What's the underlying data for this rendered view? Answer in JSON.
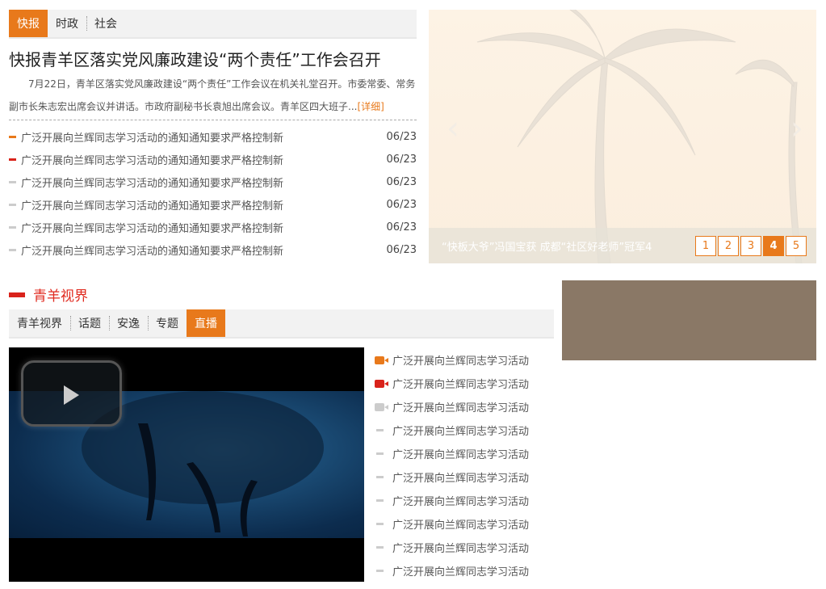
{
  "top_tabs": [
    {
      "label": "快报",
      "active": true
    },
    {
      "label": "时政"
    },
    {
      "label": "社会"
    }
  ],
  "headline": "快报青羊区落实党风廉政建设“两个责任”工作会召开",
  "summary": {
    "text": "7月22日，青羊区落实党风廉政建设“两个责任”工作会议在机关礼堂召开。市委常委、常务副市长朱志宏出席会议并讲话。市政府副秘书长袁旭出席会议。青羊区四大班子...",
    "more_label": "[详细]"
  },
  "news": [
    {
      "title": "广泛开展向兰辉同志学习活动的通知通知要求严格控制新",
      "date": "06/23",
      "bullet": "#e8791b"
    },
    {
      "title": "广泛开展向兰辉同志学习活动的通知通知要求严格控制新",
      "date": "06/23",
      "bullet": "#d9231b"
    },
    {
      "title": "广泛开展向兰辉同志学习活动的通知通知要求严格控制新",
      "date": "06/23",
      "bullet": "#cccccc"
    },
    {
      "title": "广泛开展向兰辉同志学习活动的通知通知要求严格控制新",
      "date": "06/23",
      "bullet": "#cccccc"
    },
    {
      "title": "广泛开展向兰辉同志学习活动的通知通知要求严格控制新",
      "date": "06/23",
      "bullet": "#cccccc"
    },
    {
      "title": "广泛开展向兰辉同志学习活动的通知通知要求严格控制新",
      "date": "06/23",
      "bullet": "#cccccc"
    }
  ],
  "slider": {
    "caption": "“快板大爷”冯国宝获 成都“社区好老师”冠军4",
    "pages": [
      "1",
      "2",
      "3",
      "4",
      "5"
    ],
    "active_page": "4"
  },
  "section_title": "青羊视界",
  "section_tabs": [
    {
      "label": "青羊视界"
    },
    {
      "label": "话题"
    },
    {
      "label": "安逸"
    },
    {
      "label": "专题"
    },
    {
      "label": "直播",
      "active": true
    }
  ],
  "video_list": [
    {
      "title": "广泛开展向兰辉同志学习活动",
      "icon": "video-camera-icon",
      "color": "#e8791b"
    },
    {
      "title": "广泛开展向兰辉同志学习活动",
      "icon": "video-camera-icon",
      "color": "#d9231b"
    },
    {
      "title": "广泛开展向兰辉同志学习活动",
      "icon": "video-camera-icon",
      "color": "#cccccc"
    },
    {
      "title": "广泛开展向兰辉同志学习活动",
      "icon": "dash-bullet-icon",
      "color": "#cccccc"
    },
    {
      "title": "广泛开展向兰辉同志学习活动",
      "icon": "dash-bullet-icon",
      "color": "#cccccc"
    },
    {
      "title": "广泛开展向兰辉同志学习活动",
      "icon": "dash-bullet-icon",
      "color": "#cccccc"
    },
    {
      "title": "广泛开展向兰辉同志学习活动",
      "icon": "dash-bullet-icon",
      "color": "#cccccc"
    },
    {
      "title": "广泛开展向兰辉同志学习活动",
      "icon": "dash-bullet-icon",
      "color": "#cccccc"
    },
    {
      "title": "广泛开展向兰辉同志学习活动",
      "icon": "dash-bullet-icon",
      "color": "#cccccc"
    },
    {
      "title": "广泛开展向兰辉同志学习活动",
      "icon": "dash-bullet-icon",
      "color": "#cccccc"
    }
  ],
  "colors": {
    "accent": "#e8791b",
    "red": "#d9231b",
    "ad_box": "#8a7866"
  }
}
